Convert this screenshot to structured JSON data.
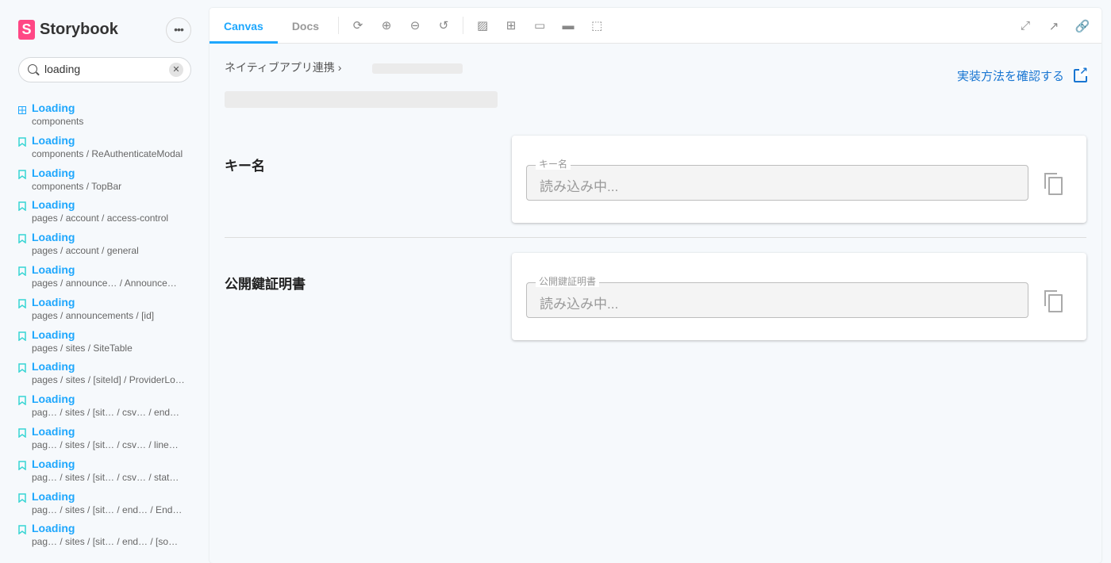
{
  "sidebar": {
    "brand": "Storybook",
    "logo_letter": "S",
    "menu_label": "•••",
    "search": {
      "value": "loading",
      "clear": "✕"
    },
    "items": [
      {
        "title": "Loading",
        "path": "components",
        "icon": "component-grid-icon"
      },
      {
        "title": "Loading",
        "path": "components / ReAuthenticateModal",
        "icon": "bookmark-icon"
      },
      {
        "title": "Loading",
        "path": "components / TopBar",
        "icon": "bookmark-icon"
      },
      {
        "title": "Loading",
        "path": "pages / account / access-control",
        "icon": "bookmark-icon"
      },
      {
        "title": "Loading",
        "path": "pages / account / general",
        "icon": "bookmark-icon"
      },
      {
        "title": "Loading",
        "path": "pages / announce…   / Announce…",
        "icon": "bookmark-icon"
      },
      {
        "title": "Loading",
        "path": "pages / announcements / [id]",
        "icon": "bookmark-icon"
      },
      {
        "title": "Loading",
        "path": "pages / sites / SiteTable",
        "icon": "bookmark-icon"
      },
      {
        "title": "Loading",
        "path": "pages / sites / [siteId] / ProviderLo…",
        "icon": "bookmark-icon"
      },
      {
        "title": "Loading",
        "path": "pag…  / sites / [sit…   / csv…   / end…",
        "icon": "bookmark-icon"
      },
      {
        "title": "Loading",
        "path": "pag…  / sites / [sit…   / csv…   / line…",
        "icon": "bookmark-icon"
      },
      {
        "title": "Loading",
        "path": "pag…  / sites / [sit…   / csv…   / stat…",
        "icon": "bookmark-icon"
      },
      {
        "title": "Loading",
        "path": "pag…  / sites / [sit…   / end…   / End…",
        "icon": "bookmark-icon"
      },
      {
        "title": "Loading",
        "path": "pag…  / sites / [sit…   / end…   / [so…",
        "icon": "bookmark-icon"
      }
    ]
  },
  "toolbar": {
    "tabs": [
      "Canvas",
      "Docs"
    ],
    "active_tab": "Canvas"
  },
  "content": {
    "breadcrumb": "ネイティブアプリ連携 ›",
    "implementation_link": "実装方法を確認する",
    "sections": [
      {
        "label": "キー名",
        "field_label": "キー名",
        "field_value": "読み込み中..."
      },
      {
        "label": "公開鍵証明書",
        "field_label": "公開鍵証明書",
        "field_value": "読み込み中..."
      }
    ]
  },
  "colors": {
    "accent": "#1ea7fd",
    "brand": "#ff4785",
    "link": "#1976d2"
  }
}
